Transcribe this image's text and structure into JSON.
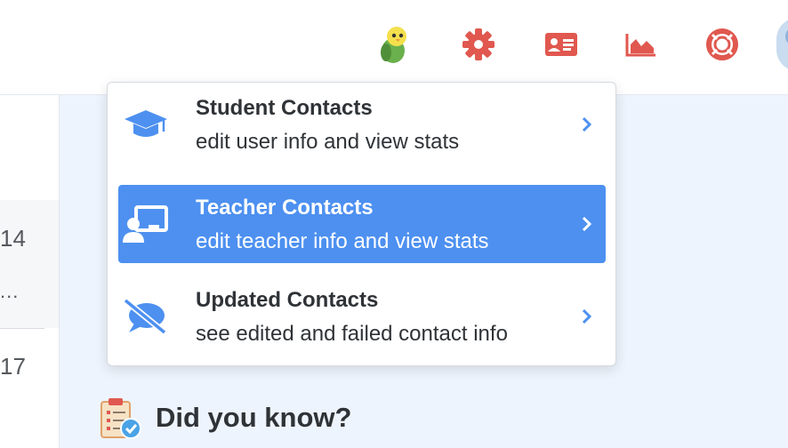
{
  "topbar": {
    "icons": [
      "parrot-mascot-icon",
      "gear-icon",
      "id-card-icon",
      "area-chart-icon",
      "lifebuoy-icon",
      "avatar"
    ],
    "accent_color": "#e0584f"
  },
  "sidebar": {
    "values": [
      "14",
      "...",
      "17"
    ]
  },
  "dropdown": {
    "items": [
      {
        "title": "Student Contacts",
        "subtitle": "edit user info and view stats",
        "icon": "graduation-cap-icon",
        "active": false
      },
      {
        "title": "Teacher Contacts",
        "subtitle": "edit teacher info and view stats",
        "icon": "teacher-board-icon",
        "active": true
      },
      {
        "title": "Updated Contacts",
        "subtitle": "see edited and failed contact info",
        "icon": "comment-slash-icon",
        "active": false
      }
    ],
    "highlight_color": "#4d90f0",
    "icon_color": "#4d90f0"
  },
  "main": {
    "did_you_know": "Did you know?"
  }
}
